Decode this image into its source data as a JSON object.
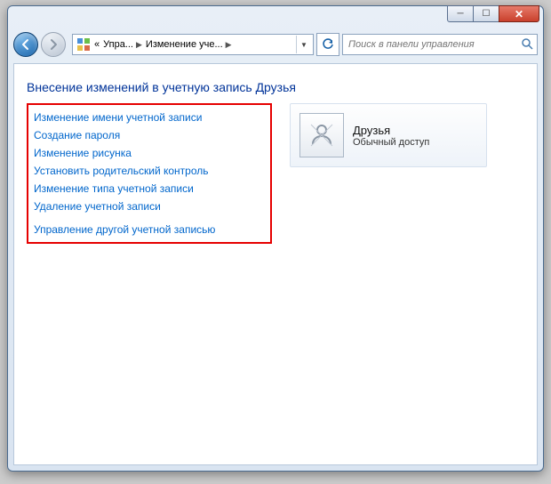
{
  "breadcrumb": {
    "sep": "«",
    "item1": "Упра...",
    "item2": "Изменение уче..."
  },
  "search": {
    "placeholder": "Поиск в панели управления"
  },
  "page": {
    "title": "Внесение изменений в учетную запись Друзья"
  },
  "links": {
    "items": [
      "Изменение имени учетной записи",
      "Создание пароля",
      "Изменение рисунка",
      "Установить родительский контроль",
      "Изменение типа учетной записи",
      "Удаление учетной записи"
    ],
    "manage_other": "Управление другой учетной записью"
  },
  "account": {
    "name": "Друзья",
    "type": "Обычный доступ"
  }
}
